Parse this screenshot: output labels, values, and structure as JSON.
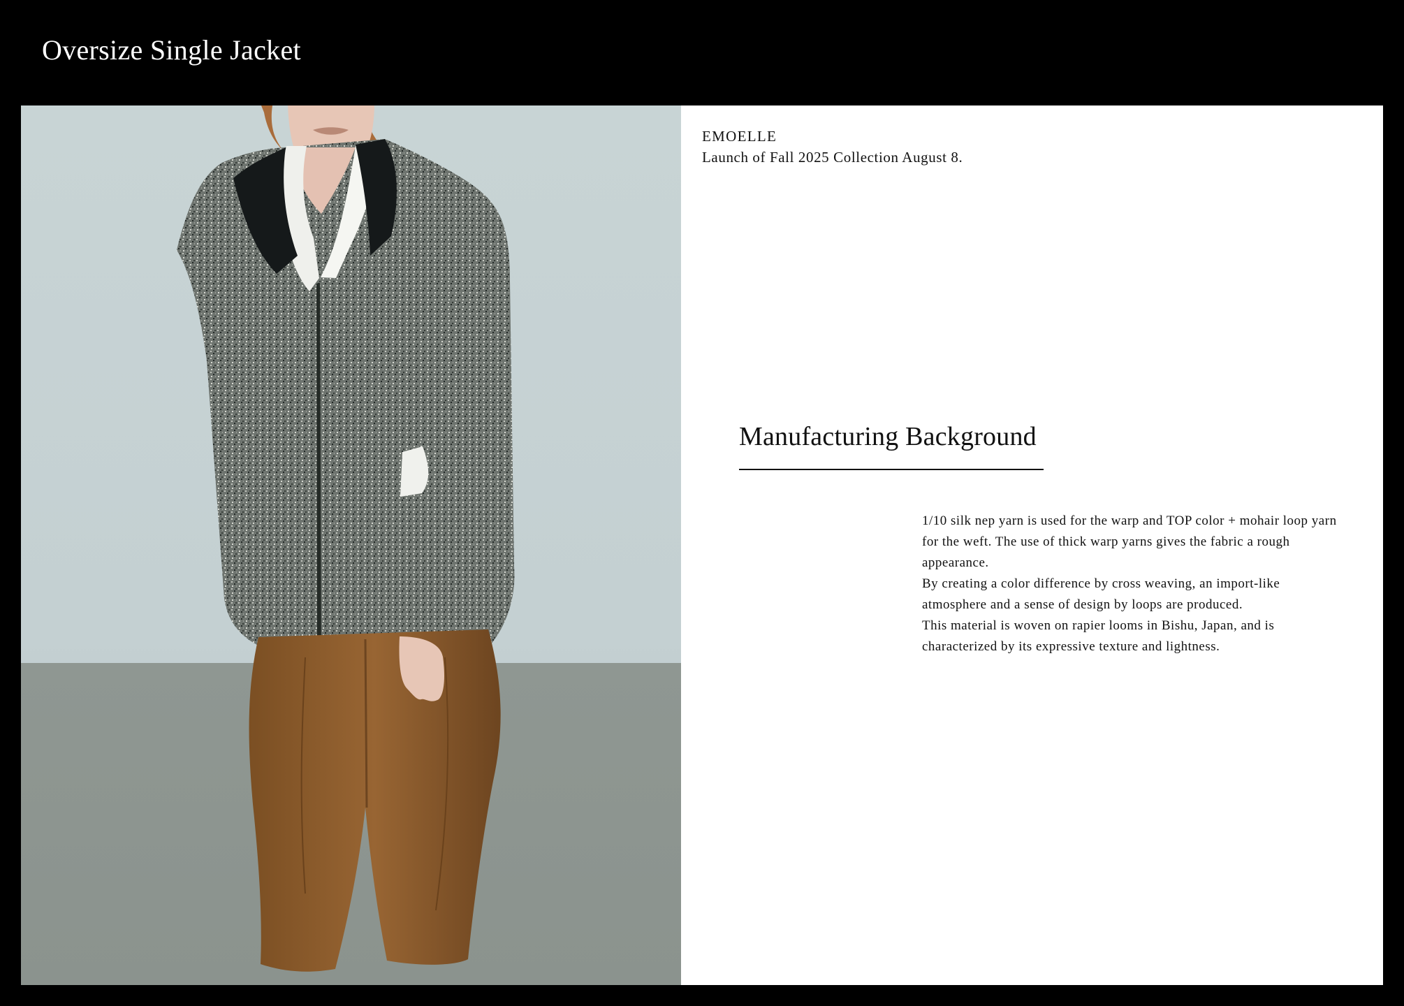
{
  "header": {
    "title": "Oversize Single Jacket"
  },
  "hero_image": {
    "description_icon": "fashion-model-photo",
    "colors": {
      "wall": "#c8d4d5",
      "floor": "#8b938e",
      "jacket_dark": "#2c3430",
      "jacket_light": "#a8aca6",
      "collar": "#15191a",
      "trousers": "#8c5e2c",
      "shirt": "#eff0ec",
      "skin": "#e7c6b6",
      "hair": "#a96c3b"
    }
  },
  "content": {
    "brand": "EMOELLE",
    "launch": "Launch of Fall 2025 Collection August 8.",
    "section_title": "Manufacturing Background",
    "paragraphs": [
      "1/10 silk nep yarn is used for the warp and TOP color + mohair loop yarn for the weft. The use of thick warp yarns gives the fabric a rough appearance.",
      "By creating a color difference by cross weaving, an import-like atmosphere and a sense of design by loops are produced.",
      " This material is woven on rapier looms in Bishu, Japan, and is characterized by its expressive texture and lightness."
    ]
  }
}
